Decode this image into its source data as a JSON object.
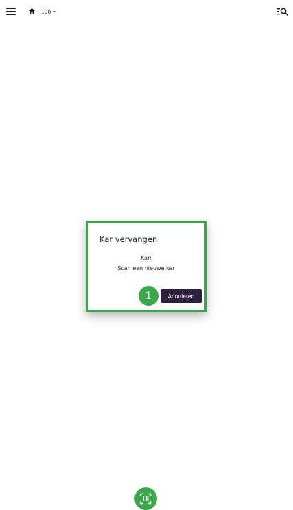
{
  "header": {
    "menu_icon": "hamburger-menu-icon",
    "home_icon": "home-icon",
    "location_value": "100",
    "location_dropdown_icon": "caret-down-icon",
    "right_icon": "list-search-icon"
  },
  "dialog": {
    "title": "Kar vervangen",
    "label": "Kar:",
    "message": "Scan een nieuwe kar",
    "cancel_label": "Annuleren"
  },
  "annotation": {
    "step_number": "1",
    "highlight_color": "#3aa84a"
  },
  "fab": {
    "icon": "barcode-scan-icon",
    "color": "#3aa84a"
  },
  "colors": {
    "button_bg": "#2e1f3d",
    "accent_green": "#3aa84a"
  }
}
